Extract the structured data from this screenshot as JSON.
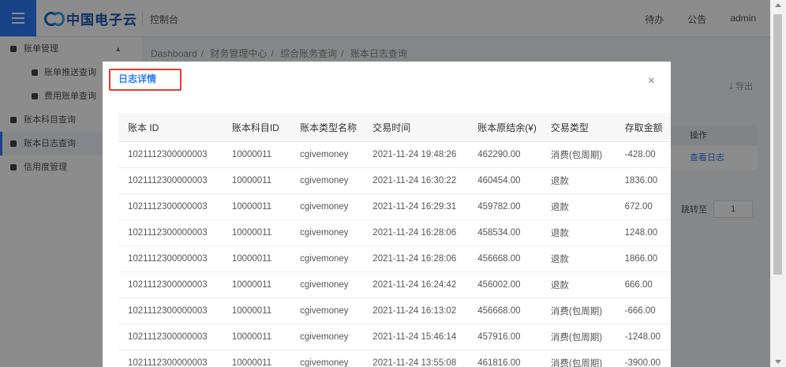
{
  "header": {
    "brand": "中国电子云",
    "title": "控制台",
    "links": [
      "待办",
      "公告",
      "admin"
    ]
  },
  "sidebar": {
    "items": [
      {
        "label": "账单管理",
        "expanded": true
      },
      {
        "label": "账单推送查询"
      },
      {
        "label": "费用账单查询"
      },
      {
        "label": "账本科目查询"
      },
      {
        "label": "账本日志查询",
        "active": true
      },
      {
        "label": "信用度管理"
      }
    ]
  },
  "breadcrumb": [
    "Dashboard",
    "财务管理中心",
    "综合账务查询",
    "账本日志查询"
  ],
  "background": {
    "export_label": "导出",
    "op_header": "操作",
    "op_link": "查看日志",
    "jump_label": "跳转至",
    "jump_value": "1"
  },
  "modal": {
    "title": "日志详情",
    "close": "×",
    "columns": [
      "账本 ID",
      "账本科目ID",
      "账本类型名称",
      "交易时间",
      "账本原结余(¥)",
      "交易类型",
      "存取金额"
    ],
    "rows": [
      [
        "1021112300000003",
        "10000011",
        "cgivemoney",
        "2021-11-24 19:48:26",
        "462290.00",
        "消费(包周期)",
        "-428.00"
      ],
      [
        "1021112300000003",
        "10000011",
        "cgivemoney",
        "2021-11-24 16:30:22",
        "460454.00",
        "退款",
        "1836.00"
      ],
      [
        "1021112300000003",
        "10000011",
        "cgivemoney",
        "2021-11-24 16:29:31",
        "459782.00",
        "退款",
        "672.00"
      ],
      [
        "1021112300000003",
        "10000011",
        "cgivemoney",
        "2021-11-24 16:28:06",
        "458534.00",
        "退款",
        "1248.00"
      ],
      [
        "1021112300000003",
        "10000011",
        "cgivemoney",
        "2021-11-24 16:28:06",
        "456668.00",
        "退款",
        "1866.00"
      ],
      [
        "1021112300000003",
        "10000011",
        "cgivemoney",
        "2021-11-24 16:24:42",
        "456002.00",
        "退款",
        "666.00"
      ],
      [
        "1021112300000003",
        "10000011",
        "cgivemoney",
        "2021-11-24 16:13:02",
        "456668.00",
        "消费(包周期)",
        "-666.00"
      ],
      [
        "1021112300000003",
        "10000011",
        "cgivemoney",
        "2021-11-24 15:46:14",
        "457916.00",
        "消费(包周期)",
        "-1248.00"
      ],
      [
        "1021112300000003",
        "10000011",
        "cgivemoney",
        "2021-11-24 13:55:08",
        "461816.00",
        "消费(包周期)",
        "-3900.00"
      ]
    ]
  },
  "colors": {
    "accent": "#2d7df6",
    "highlight_border": "#e23a2e"
  }
}
